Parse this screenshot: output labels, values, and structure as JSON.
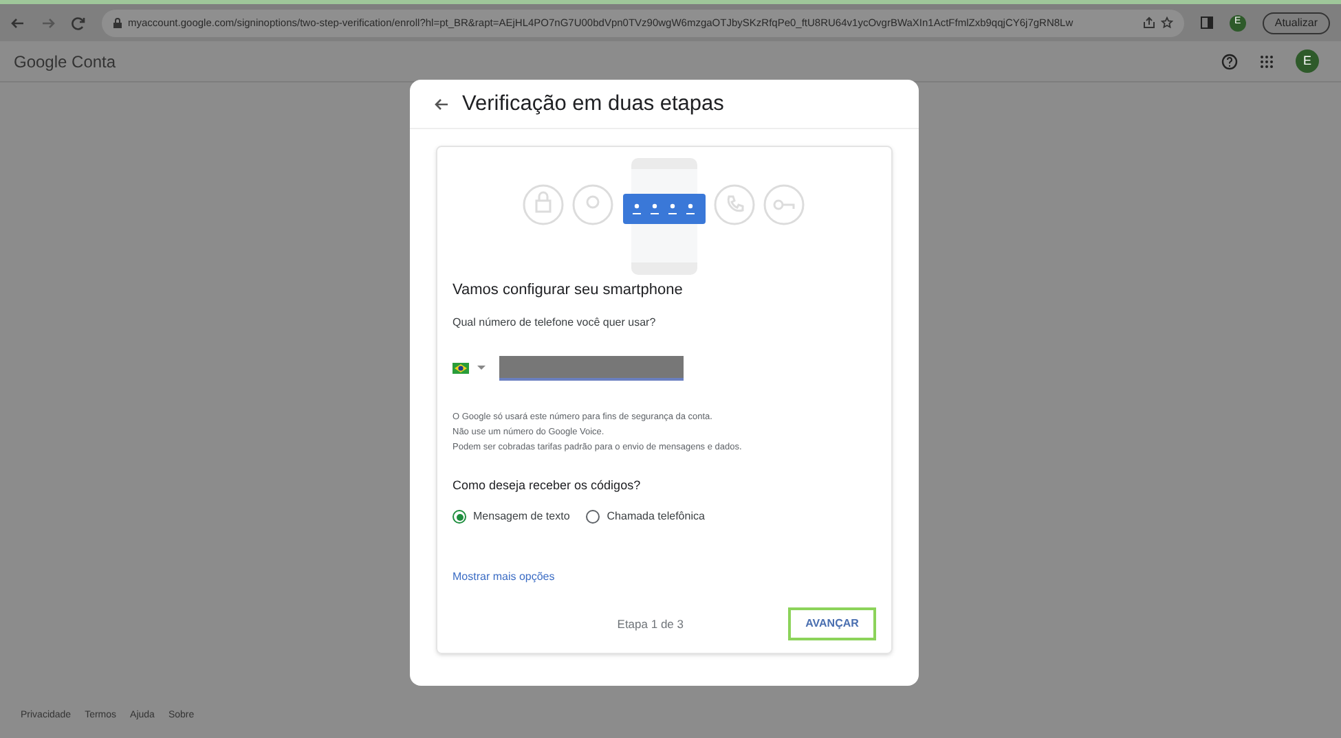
{
  "browser": {
    "url": "myaccount.google.com/signinoptions/two-step-verification/enroll?hl=pt_BR&rapt=AEjHL4PO7nG7U00bdVpn0TVz90wgW6mzgaOTJbySKzRfqPe0_ftU8RU64v1ycOvgrBWaXIn1ActFfmlZxb9qqjCY6j7gRN8Lw",
    "profile_initial": "E",
    "update_label": "Atualizar"
  },
  "header": {
    "title": "Google Conta",
    "avatar_initial": "E"
  },
  "dialog": {
    "title": "Verificação em duas etapas",
    "heading": "Vamos configurar seu smartphone",
    "phone_question": "Qual número de telefone você quer usar?",
    "notes": [
      "O Google só usará este número para fins de segurança da conta.",
      "Não use um número do Google Voice.",
      "Podem ser cobradas tarifas padrão para o envio de mensagens e dados."
    ],
    "codes_question": "Como deseja receber os códigos?",
    "options": [
      {
        "label": "Mensagem de texto",
        "selected": true
      },
      {
        "label": "Chamada telefônica",
        "selected": false
      }
    ],
    "more_link": "Mostrar mais opções",
    "step": "Etapa 1 de 3",
    "next_button": "AVANÇAR"
  },
  "footer": [
    "Privacidade",
    "Termos",
    "Ajuda",
    "Sobre"
  ]
}
